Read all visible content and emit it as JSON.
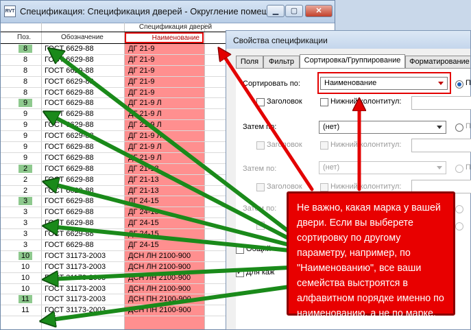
{
  "window": {
    "icon_label": "RVT",
    "title": "Спецификация: Спецификация дверей - Округление помеще..."
  },
  "schedule": {
    "title": "Спецификация дверей",
    "columns": [
      "Поз.",
      "Обозначение",
      "Наименование"
    ],
    "rows": [
      {
        "pos": "8",
        "designation": "ГОСТ 6629-88",
        "name": "ДГ 21-9",
        "hl": true
      },
      {
        "pos": "8",
        "designation": "ГОСТ 6629-88",
        "name": "ДГ 21-9",
        "hl": false
      },
      {
        "pos": "8",
        "designation": "ГОСТ 6629-88",
        "name": "ДГ 21-9",
        "hl": false
      },
      {
        "pos": "8",
        "designation": "ГОСТ 6629-88",
        "name": "ДГ 21-9",
        "hl": false
      },
      {
        "pos": "8",
        "designation": "ГОСТ 6629-88",
        "name": "ДГ 21-9",
        "hl": false
      },
      {
        "pos": "9",
        "designation": "ГОСТ 6629-88",
        "name": "ДГ 21-9 Л",
        "hl": true
      },
      {
        "pos": "9",
        "designation": "ГОСТ 6629-88",
        "name": "ДГ 21-9 Л",
        "hl": false
      },
      {
        "pos": "9",
        "designation": "ГОСТ 6629-88",
        "name": "ДГ 21-9 Л",
        "hl": false
      },
      {
        "pos": "9",
        "designation": "ГОСТ 6629-88",
        "name": "ДГ 21-9 Л",
        "hl": false
      },
      {
        "pos": "9",
        "designation": "ГОСТ 6629-88",
        "name": "ДГ 21-9 Л",
        "hl": false
      },
      {
        "pos": "9",
        "designation": "ГОСТ 6629-88",
        "name": "ДГ 21-9 Л",
        "hl": false
      },
      {
        "pos": "2",
        "designation": "ГОСТ 6629-88",
        "name": "ДГ 21-13",
        "hl": true
      },
      {
        "pos": "2",
        "designation": "ГОСТ 6629-88",
        "name": "ДГ 21-13",
        "hl": false
      },
      {
        "pos": "2",
        "designation": "ГОСТ 6629-88",
        "name": "ДГ 21-13",
        "hl": false
      },
      {
        "pos": "3",
        "designation": "ГОСТ 6629-88",
        "name": "ДГ 24-15",
        "hl": true
      },
      {
        "pos": "3",
        "designation": "ГОСТ 6629-88",
        "name": "ДГ 24-15",
        "hl": false
      },
      {
        "pos": "3",
        "designation": "ГОСТ 6629-88",
        "name": "ДГ 24-15",
        "hl": false
      },
      {
        "pos": "3",
        "designation": "ГОСТ 6629-88",
        "name": "ДГ 24-15",
        "hl": false
      },
      {
        "pos": "3",
        "designation": "ГОСТ 6629-88",
        "name": "ДГ 24-15",
        "hl": false
      },
      {
        "pos": "10",
        "designation": "ГОСТ 31173-2003",
        "name": "ДСН ЛН 2100-900",
        "hl": true
      },
      {
        "pos": "10",
        "designation": "ГОСТ 31173-2003",
        "name": "ДСН ЛН 2100-900",
        "hl": false
      },
      {
        "pos": "10",
        "designation": "ГОСТ 31173-2003",
        "name": "ДСН ЛН 2100-900",
        "hl": false
      },
      {
        "pos": "10",
        "designation": "ГОСТ 31173-2003",
        "name": "ДСН ЛН 2100-900",
        "hl": false
      },
      {
        "pos": "11",
        "designation": "ГОСТ 31173-2003",
        "name": "ДСН ПН 2100-900",
        "hl": true
      },
      {
        "pos": "11",
        "designation": "ГОСТ 31173-2003",
        "name": "ДСН ПН 2100-900",
        "hl": false
      }
    ]
  },
  "dialog": {
    "title": "Свойства спецификации",
    "tabs": [
      "Поля",
      "Фильтр",
      "Сортировка/Группирование",
      "Форматирование"
    ],
    "sort_by_label": "Сортировать по:",
    "sort_by_value": "Наименование",
    "then_by_label_1": "Затем по:",
    "then_by_label_2": "Затем по:",
    "then_by_label_3": "Затем по:",
    "none_value": "(нет)",
    "header_label": "Заголовок",
    "footer_label": "Нижний колонтитул:",
    "radio_label": "По",
    "grand_totals_label": "Общий",
    "itemize_label": "Для каж"
  },
  "callout": {
    "text": "Не важно, какая марка у вашей двери. Если вы выберете сортировку по другому параметру, например, по \"Наименованию\", все ваши семейства выстроятся в алфавитном порядке именно по наименованию, а не по марке."
  },
  "colors": {
    "name_column": "#ff8f8f",
    "highlight_red": "#e30000",
    "mark_green": "#8ec98e",
    "arrow_green": "#1a8a1a"
  }
}
